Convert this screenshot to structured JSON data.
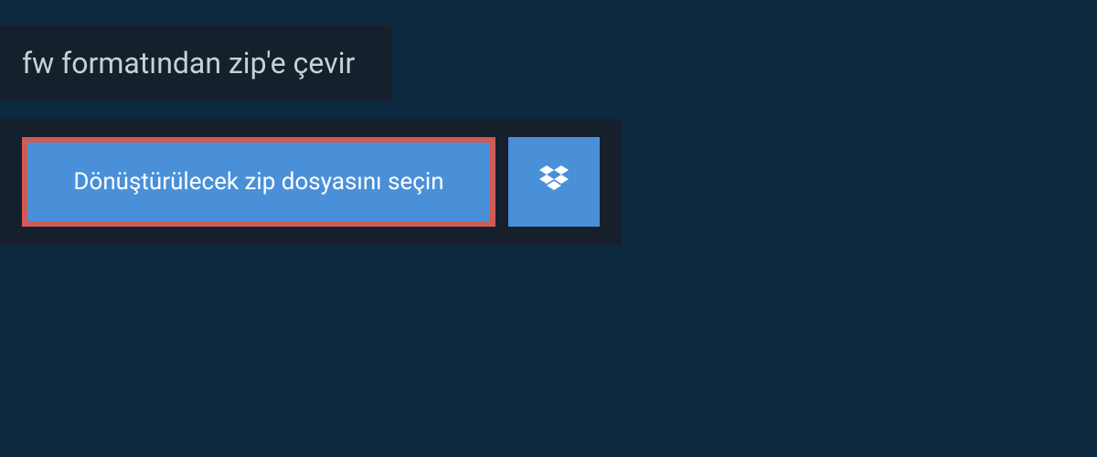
{
  "header": {
    "title": "fw formatından zip'e çevir"
  },
  "upload": {
    "select_file_label": "Dönüştürülecek zip dosyasını seçin",
    "cloud_provider": "dropbox"
  },
  "colors": {
    "page_bg": "#0d2940",
    "panel_bg": "#16202c",
    "button_bg": "#4a90d9",
    "button_border_highlight": "#cf5b56",
    "text_light": "#ffffff",
    "text_muted": "#c8d0d8"
  }
}
